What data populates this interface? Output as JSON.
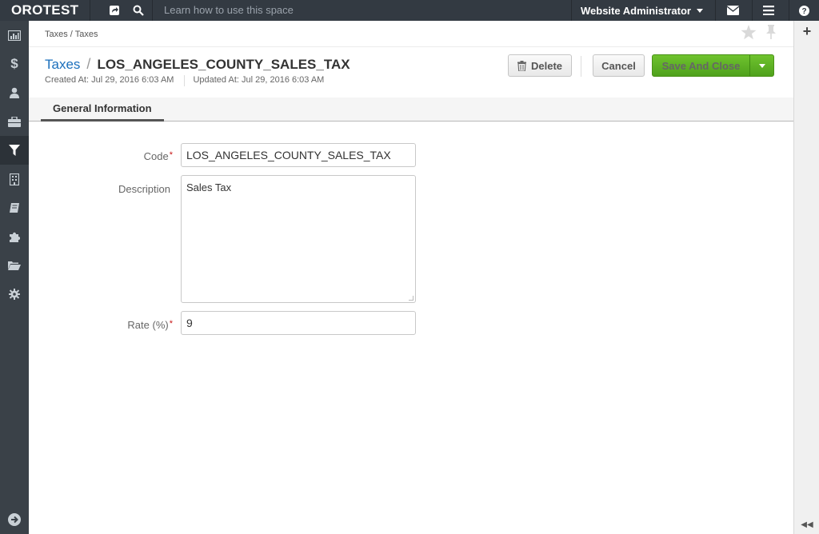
{
  "topbar": {
    "logo": "OROTEST",
    "help_text": "Learn how to use this space",
    "user_menu_label": "Website Administrator"
  },
  "sidebar": {
    "items": [
      {
        "icon": "dashboard-icon"
      },
      {
        "icon": "dollar-icon"
      },
      {
        "icon": "user-icon"
      },
      {
        "icon": "briefcase-icon"
      },
      {
        "icon": "filter-icon",
        "active": true
      },
      {
        "icon": "building-icon"
      },
      {
        "icon": "book-icon"
      },
      {
        "icon": "puzzle-icon"
      },
      {
        "icon": "folder-open-icon"
      },
      {
        "icon": "gear-icon"
      }
    ],
    "bottom_icon": "arrow-right-circle-icon"
  },
  "breadcrumb": "Taxes / Taxes",
  "title": {
    "link": "Taxes",
    "separator": "/",
    "name": "LOS_ANGELES_COUNTY_SALES_TAX"
  },
  "meta": {
    "created": "Created At: Jul 29, 2016 6:03 AM",
    "updated": "Updated At: Jul 29, 2016 6:03 AM"
  },
  "actions": {
    "delete_label": "Delete",
    "cancel_label": "Cancel",
    "save_label": "Save And Close"
  },
  "tabs": [
    {
      "label": "General Information",
      "active": true
    }
  ],
  "form": {
    "code_label": "Code",
    "code_value": "LOS_ANGELES_COUNTY_SALES_TAX",
    "description_label": "Description",
    "description_value": "Sales Tax",
    "rate_label": "Rate (%)",
    "rate_value": "9",
    "required_marker": "*"
  },
  "colors": {
    "topbar_bg": "#333a42",
    "sidebar_bg": "#3a4148",
    "link": "#1b6fbc",
    "save_green": "#5cb021",
    "required": "#c81818"
  }
}
